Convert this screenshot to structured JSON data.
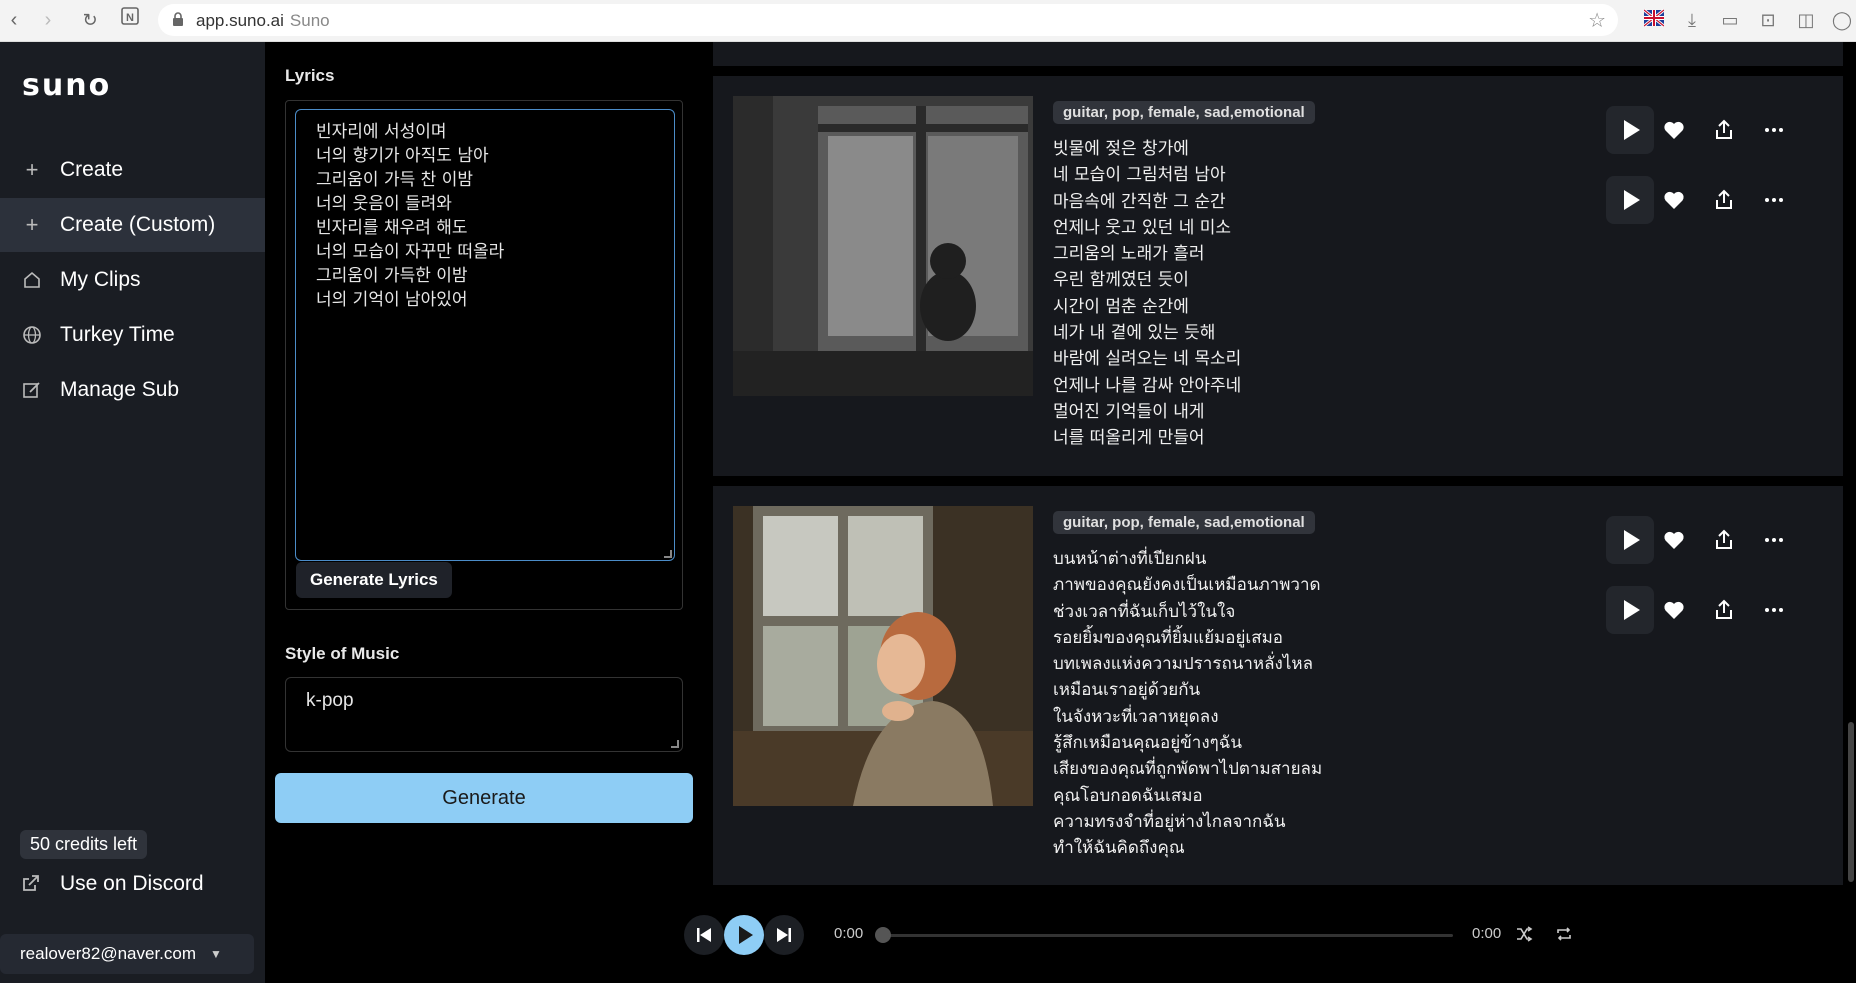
{
  "browser": {
    "url": "app.suno.ai",
    "site_name": "Suno"
  },
  "sidebar": {
    "logo": "suno",
    "items": [
      {
        "label": "Create",
        "icon": "plus-icon"
      },
      {
        "label": "Create (Custom)",
        "icon": "plus-icon"
      },
      {
        "label": "My Clips",
        "icon": "home-icon"
      },
      {
        "label": "Turkey Time",
        "icon": "globe-icon"
      },
      {
        "label": "Manage Sub",
        "icon": "edit-icon"
      }
    ],
    "credits": "50 credits left",
    "discord": "Use on Discord",
    "email": "realover82@naver.com"
  },
  "form": {
    "lyrics_label": "Lyrics",
    "lyrics_text": "빈자리에 서성이며\n너의 향기가 아직도 남아\n그리움이 가득 찬 이밤\n너의 웃음이 들려와\n빈자리를 채우려 해도\n너의 모습이 자꾸만 떠올라\n그리움이 가득한 이밤\n너의 기억이 남아있어",
    "generate_lyrics": "Generate Lyrics",
    "style_label": "Style of Music",
    "style_value": "k-pop",
    "generate": "Generate"
  },
  "cards": [
    {
      "tag": "guitar, pop, female, sad,emotional",
      "lyrics": "빗물에 젖은 창가에\n네 모습이 그림처럼 남아\n마음속에 간직한 그 순간\n언제나 웃고 있던 네 미소\n그리움의 노래가 흘러\n우린 함께였던 듯이\n시간이 멈춘 순간에\n네가 내 곁에 있는 듯해\n바람에 실려오는 네 목소리\n언제나 나를 감싸 안아주네\n멀어진 기억들이 내게\n너를 떠올리게 만들어"
    },
    {
      "tag": "guitar, pop, female, sad,emotional",
      "lyrics": "บนหน้าต่างที่เปียกฝน\nภาพของคุณยังคงเป็นเหมือนภาพวาด\nช่วงเวลาที่ฉันเก็บไว้ในใจ\nรอยยิ้มของคุณที่ยิ้มแย้มอยู่เสมอ\nบทเพลงแห่งความปรารถนาหลั่งไหล\nเหมือนเราอยู่ด้วยกัน\nในจังหวะที่เวลาหยุดลง\nรู้สึกเหมือนคุณอยู่ข้างๆฉัน\nเสียงของคุณที่ถูกพัดพาไปตามสายลม\nคุณโอบกอดฉันเสมอ\nความทรงจำที่อยู่ห่างไกลจากฉัน\nทำให้ฉันคิดถึงคุณ"
    }
  ],
  "player": {
    "current_time": "0:00",
    "total_time": "0:00",
    "progress": 0
  },
  "colors": {
    "accent": "#8ecdf5",
    "sidebar_bg": "#1a1d23",
    "card_bg": "#16181d"
  }
}
